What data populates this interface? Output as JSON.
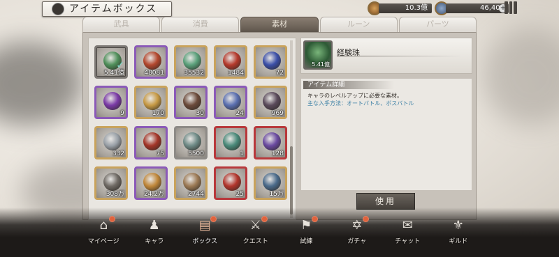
{
  "header": {
    "title": "アイテムボックス",
    "currencies": [
      {
        "icon": "gold-coin-icon",
        "value": "10.3億"
      },
      {
        "icon": "gem-icon",
        "value": "46,401"
      }
    ],
    "plus_label": "+"
  },
  "tabs": [
    {
      "label": "武具"
    },
    {
      "label": "消費"
    },
    {
      "label": "素材",
      "active": true
    },
    {
      "label": "ルーン"
    },
    {
      "label": "パーツ"
    }
  ],
  "items": [
    {
      "count": "5.41億",
      "rarity": "gray",
      "icon": "green-orb-icon",
      "color": "#4f8f5a",
      "selected": true
    },
    {
      "count": "48081",
      "rarity": "purple",
      "icon": "red-orb-icon",
      "color": "#b3472d"
    },
    {
      "count": "35532",
      "rarity": "gold",
      "icon": "green-potion-icon",
      "color": "#5aa07a"
    },
    {
      "count": "1484",
      "rarity": "gold",
      "icon": "red-potion-icon",
      "color": "#b53a2c"
    },
    {
      "count": "72",
      "rarity": "gold",
      "icon": "blue-potion-icon",
      "color": "#3b4fa8"
    },
    {
      "count": "9",
      "rarity": "purple",
      "icon": "purple-potion-icon",
      "color": "#7a3aa6"
    },
    {
      "count": "170",
      "rarity": "gold",
      "icon": "golden-ticket-icon",
      "color": "#c79a45"
    },
    {
      "count": "30",
      "rarity": "purple",
      "icon": "dark-ticket-icon",
      "color": "#6b4a3a"
    },
    {
      "count": "24",
      "rarity": "purple",
      "icon": "crystal-ticket-icon",
      "color": "#5a6fb0"
    },
    {
      "count": "969",
      "rarity": "gold",
      "icon": "scroll-icon",
      "color": "#5a4a5a"
    },
    {
      "count": "332",
      "rarity": "gold",
      "icon": "paper-scroll-icon",
      "color": "#9aa1a8"
    },
    {
      "count": "75",
      "rarity": "purple",
      "icon": "apple-icon",
      "color": "#a33528"
    },
    {
      "count": "5500",
      "rarity": "gray",
      "icon": "heart-icon",
      "color": "#6e8a86"
    },
    {
      "count": "1",
      "rarity": "red",
      "icon": "wing-feather-icon",
      "color": "#4a8a7a"
    },
    {
      "count": "128",
      "rarity": "red",
      "icon": "amethyst-icon",
      "color": "#6a4aa0"
    },
    {
      "count": "308万",
      "rarity": "gold",
      "icon": "ore-icon",
      "color": "#6f6a64"
    },
    {
      "count": "24.2万",
      "rarity": "purple",
      "icon": "gold-nugget-icon",
      "color": "#c0873a"
    },
    {
      "count": "2744",
      "rarity": "gold",
      "icon": "tablet-icon",
      "color": "#9c7a55"
    },
    {
      "count": "25",
      "rarity": "red",
      "icon": "ruby-icon",
      "color": "#b2352c"
    },
    {
      "count": "15万",
      "rarity": "gold",
      "icon": "rune-coin-icon",
      "color": "#4a6a8a"
    }
  ],
  "detail": {
    "name": "経験珠",
    "count": "5.41億",
    "section_title": "アイテム詳細",
    "description": "キャラのレベルアップに必要な素材。",
    "source": "主な入手方法：オートバトル、ボスバトル",
    "use_button": "使用"
  },
  "nav": [
    {
      "label": "マイページ",
      "glyph": "⌂",
      "dot": true
    },
    {
      "label": "キャラ",
      "glyph": "♟",
      "dot": false
    },
    {
      "label": "ボックス",
      "glyph": "▤",
      "dot": true,
      "active": true
    },
    {
      "label": "クエスト",
      "glyph": "⚔",
      "dot": true
    },
    {
      "label": "試練",
      "glyph": "⚑",
      "dot": true
    },
    {
      "label": "ガチャ",
      "glyph": "✡",
      "dot": true
    },
    {
      "label": "チャット",
      "glyph": "✉",
      "dot": false
    },
    {
      "label": "ギルド",
      "glyph": "⚜",
      "dot": false
    }
  ]
}
